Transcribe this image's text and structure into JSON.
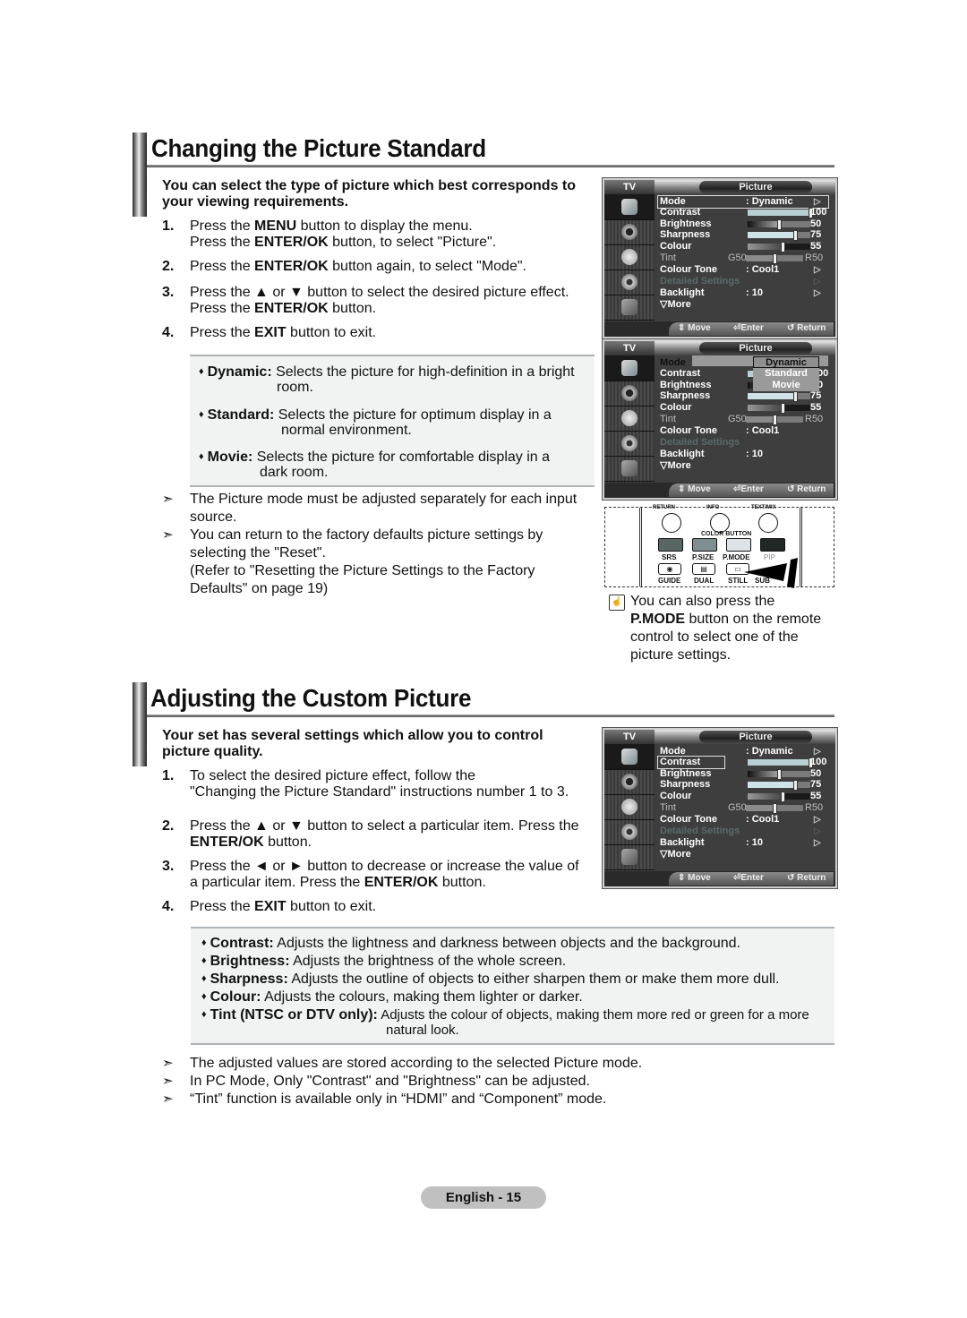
{
  "section1": {
    "title": "Changing the Picture Standard",
    "intro_line1": "You can select the type of picture which best corresponds to",
    "intro_line2": "your viewing requirements.",
    "steps": [
      {
        "num": "1.",
        "line1_pre": "Press the ",
        "line1_bold": "MENU",
        "line1_post": " button to display the menu.",
        "line2_pre": "Press the ",
        "line2_bold": "ENTER/OK",
        "line2_post": " button, to select \"Picture\"."
      },
      {
        "num": "2.",
        "line1_pre": "Press the ",
        "line1_bold": "ENTER/OK",
        "line1_post": " button again, to select \"Mode\"."
      },
      {
        "num": "3.",
        "line1_pre": "Press the ▲ or ▼ button to select the desired picture effect.",
        "line2_pre": "Press the ",
        "line2_bold": "ENTER/OK",
        "line2_post": " button."
      },
      {
        "num": "4.",
        "line1_pre": "Press the ",
        "line1_bold": "EXIT",
        "line1_post": " button to exit."
      }
    ],
    "modes": [
      {
        "name": "Dynamic:",
        "line1": " Selects the picture for high-definition in a bright",
        "line2": "room."
      },
      {
        "name": "Standard:",
        "line1": " Selects the picture for optimum display in a",
        "line2": "normal environment."
      },
      {
        "name": "Movie:",
        "line1": " Selects the picture for comfortable display in a",
        "line2": "dark room."
      }
    ],
    "notes": [
      {
        "lines": [
          "The Picture mode must be adjusted separately for each input",
          "source."
        ]
      },
      {
        "lines": [
          "You can return to the factory defaults picture settings by",
          "selecting the \"Reset\".",
          "(Refer to \"Resetting the Picture Settings to the Factory",
          "Defaults\" on page 19)"
        ]
      }
    ],
    "note_marker": "➣",
    "tip": {
      "icon": "hand-icon",
      "line1": "You can also press the",
      "line2_bold": "P.MODE",
      "line2_post": " button on the remote",
      "line3": "control to select one of the",
      "line4": "picture settings."
    }
  },
  "osd_common": {
    "tv_label": "TV",
    "menu_title": "Picture",
    "rows": {
      "mode": "Mode",
      "mode_value": ": Dynamic",
      "contrast": "Contrast",
      "contrast_value": "100",
      "brightness": "Brightness",
      "brightness_value": "50",
      "sharpness": "Sharpness",
      "sharpness_value": "75",
      "colour": "Colour",
      "colour_value": "55",
      "tint": "Tint",
      "tint_g": "G50",
      "tint_r": "R50",
      "colour_tone": "Colour Tone",
      "colour_tone_value": ": Cool1",
      "detailed": "Detailed Settings",
      "backlight": "Backlight",
      "backlight_value": ": 10",
      "more": "▽More"
    },
    "slider_levels": {
      "contrast": 100,
      "brightness": 50,
      "sharpness": 75,
      "colour": 55,
      "tint": 50
    },
    "footer": {
      "move": "⇕ Move",
      "enter": "⏎Enter",
      "return": "↺ Return"
    },
    "arrow": "▷",
    "colon": ":",
    "dropdown_options": [
      "Dynamic",
      "Standard",
      "Movie"
    ],
    "dropdown_selected": "Dynamic",
    "contrast_partial": "00",
    "brightness_partial": "0"
  },
  "remote": {
    "top_labels": [
      "RETURN",
      "INFO",
      "TEXT/MIX"
    ],
    "color_button_label": "COLOR BUTTON",
    "row1_labels": [
      "SRS",
      "P.SIZE",
      "P.MODE",
      "PIP"
    ],
    "row2_labels": [
      "GUIDE",
      "DUAL",
      "STILL",
      "SUB"
    ],
    "colors": [
      "#5a6663",
      "#7f8e91",
      "#dde3e6",
      "#222826"
    ]
  },
  "section2": {
    "title": "Adjusting the Custom Picture",
    "intro_line1": "Your set has several settings which allow you to control",
    "intro_line2": "picture quality.",
    "steps": [
      {
        "num": "1.",
        "line1_pre": "To select the desired picture effect, follow the",
        "line2_pre": "\"Changing the Picture Standard\" instructions number 1 to 3."
      },
      {
        "num": "2.",
        "line1_pre": "Press the ▲ or ▼ button to select a particular item. Press the",
        "line2_bold": "ENTER/OK",
        "line2_post": " button."
      },
      {
        "num": "3.",
        "line1_pre": "Press the ◄ or ► button to decrease or increase the value of",
        "line2_pre": "a particular item. Press the ",
        "line2_bold": "ENTER/OK",
        "line2_post": " button."
      },
      {
        "num": "4.",
        "line1_pre": "Press the ",
        "line1_bold": "EXIT",
        "line1_post": " button to exit."
      }
    ],
    "items": [
      {
        "name": "Contrast:",
        "text": " Adjusts the lightness and darkness between objects and the background."
      },
      {
        "name": "Brightness:",
        "text": " Adjusts the brightness of the whole screen."
      },
      {
        "name": "Sharpness:",
        "text": " Adjusts the outline of objects to either sharpen them or make them more dull."
      },
      {
        "name": "Colour:",
        "text": " Adjusts the colours, making them lighter or darker."
      },
      {
        "name": "Tint (NTSC or DTV only):",
        "text": " Adjusts the colour of objects, making them more red or green for a more",
        "line2": "natural look."
      }
    ],
    "notes": [
      "The adjusted values are stored according to the selected Picture mode.",
      "In PC Mode, Only \"Contrast\" and \"Brightness\" can be adjusted.",
      "“Tint” function is available only in “HDMI” and “Component” mode."
    ]
  },
  "footer": {
    "page_label": "English - 15"
  }
}
